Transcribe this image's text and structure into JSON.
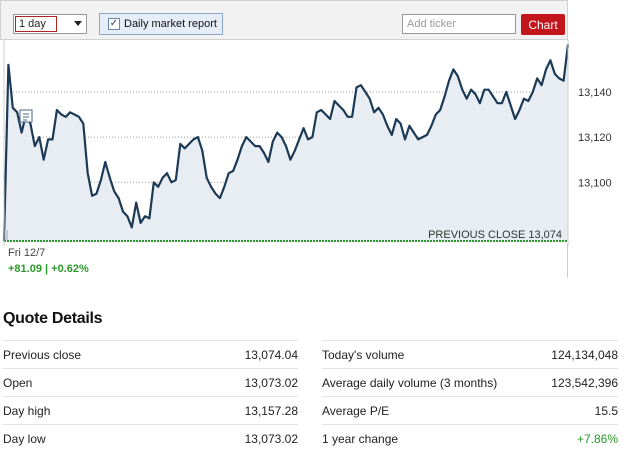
{
  "toolbar": {
    "range_value": "1 day",
    "daily_report_label": "Daily market report",
    "daily_report_checked": true,
    "ticker_placeholder": "Add ticker",
    "chart_button": "Chart"
  },
  "chart_data": {
    "type": "line",
    "y_ticks": [
      "13,140",
      "13,120",
      "13,100"
    ],
    "y_tick_values": [
      13140,
      13120,
      13100
    ],
    "ylim": [
      13074,
      13163
    ],
    "grid": true,
    "previous_close_label": "PREVIOUS CLOSE 13,074",
    "previous_close": 13074,
    "values": [
      13074,
      13152,
      13133,
      13131,
      13122,
      13130,
      13126,
      13116,
      13120,
      13110,
      13119,
      13119,
      13132,
      13130,
      13129,
      13131,
      13130,
      13129,
      13126,
      13104,
      13094,
      13095,
      13101,
      13109,
      13102,
      13096,
      13093,
      13087,
      13085,
      13080,
      13091,
      13082,
      13085,
      13084,
      13100,
      13098,
      13102,
      13104,
      13100,
      13101,
      13117,
      13115,
      13117,
      13119,
      13120,
      13114,
      13102,
      13098,
      13095,
      13093,
      13098,
      13104,
      13105,
      13110,
      13116,
      13120,
      13118,
      13116,
      13116,
      13113,
      13109,
      13118,
      13122,
      13120,
      13116,
      13110,
      13114,
      13119,
      13124,
      13119,
      13120,
      13131,
      13132,
      13130,
      13128,
      13136,
      13134,
      13132,
      13129,
      13129,
      13142,
      13143,
      13140,
      13137,
      13131,
      13133,
      13130,
      13125,
      13121,
      13128,
      13126,
      13119,
      13125,
      13122,
      13119,
      13120,
      13121,
      13125,
      13130,
      13132,
      13138,
      13145,
      13150,
      13147,
      13141,
      13137,
      13141,
      13139,
      13135,
      13141,
      13141,
      13138,
      13135,
      13135,
      13140,
      13134,
      13128,
      13132,
      13137,
      13136,
      13140,
      13146,
      13143,
      13150,
      13154,
      13148,
      13146,
      13145,
      13161
    ]
  },
  "footer": {
    "date": "Fri 12/7",
    "change": "+81.09 | +0.62%"
  },
  "quote": {
    "title": "Quote Details",
    "left": [
      {
        "label": "Previous close",
        "value": "13,074.04"
      },
      {
        "label": "Open",
        "value": "13,073.02"
      },
      {
        "label": "Day high",
        "value": "13,157.28"
      },
      {
        "label": "Day low",
        "value": "13,073.02"
      }
    ],
    "right": [
      {
        "label": "Today's volume",
        "value": "124,134,048"
      },
      {
        "label": "Average daily volume (3 months)",
        "value": "123,542,396"
      },
      {
        "label": "Average P/E",
        "value": "15.5"
      },
      {
        "label": "1 year change",
        "value": "+7.86%"
      }
    ]
  }
}
